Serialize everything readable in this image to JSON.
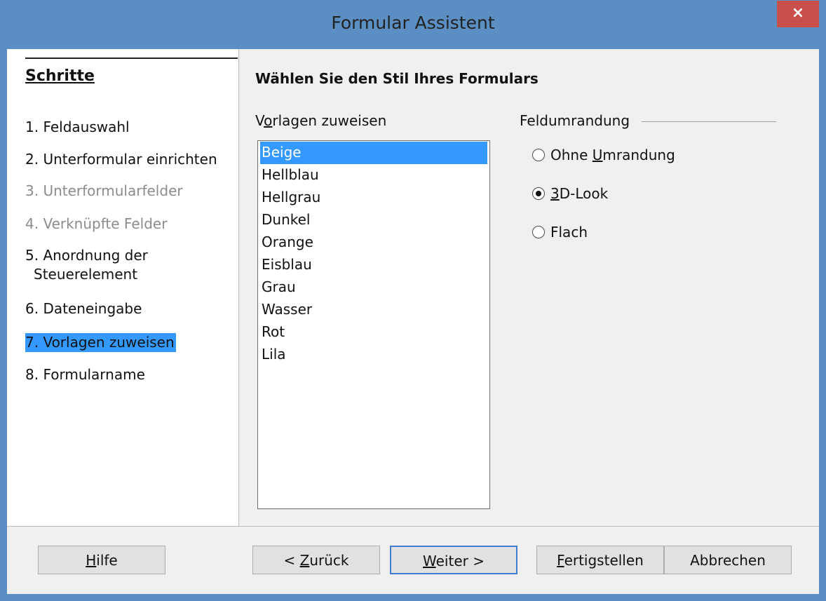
{
  "window": {
    "title": "Formular Assistent",
    "close_label": "×"
  },
  "steps": {
    "title": "Schritte",
    "items": [
      {
        "label": "1. Feldauswahl",
        "state": "normal"
      },
      {
        "label": "2. Unterformular einrichten",
        "state": "normal"
      },
      {
        "label": "3. Unterformularfelder",
        "state": "disabled"
      },
      {
        "label": "4. Verknüpfte Felder",
        "state": "disabled"
      },
      {
        "label": "5. Anordnung der",
        "label2": "Steuerelement",
        "state": "normal"
      },
      {
        "label": "6. Dateneingabe",
        "state": "normal"
      },
      {
        "label": "7. Vorlagen zuweisen",
        "state": "selected"
      },
      {
        "label": "8. Formularname",
        "state": "normal"
      }
    ]
  },
  "main": {
    "heading": "Wählen Sie den Stil Ihres Formulars",
    "templates_label": {
      "pre": "V",
      "mnemonic": "o",
      "post": "rlagen zuweisen"
    },
    "templates": [
      "Beige",
      "Hellblau",
      "Hellgrau",
      "Dunkel",
      "Orange",
      "Eisblau",
      "Grau",
      "Wasser",
      "Rot",
      "Lila"
    ],
    "selected_template": "Beige",
    "border_group": {
      "label": "Feldumrandung",
      "options": [
        {
          "pre": "Ohne ",
          "mnemonic": "U",
          "post": "mrandung",
          "checked": false
        },
        {
          "pre": "",
          "mnemonic": "3",
          "post": "D-Look",
          "checked": true
        },
        {
          "pre": "Flach",
          "mnemonic": "",
          "post": "",
          "checked": false
        }
      ]
    }
  },
  "buttons": {
    "help": {
      "mnemonic": "H",
      "post": "ilfe"
    },
    "back": {
      "pre": "< ",
      "mnemonic": "Z",
      "post": "urück"
    },
    "next": {
      "mnemonic": "W",
      "post": "eiter >"
    },
    "finish": {
      "mnemonic": "F",
      "post": "ertigstellen"
    },
    "cancel": {
      "label": "Abbrechen"
    }
  }
}
